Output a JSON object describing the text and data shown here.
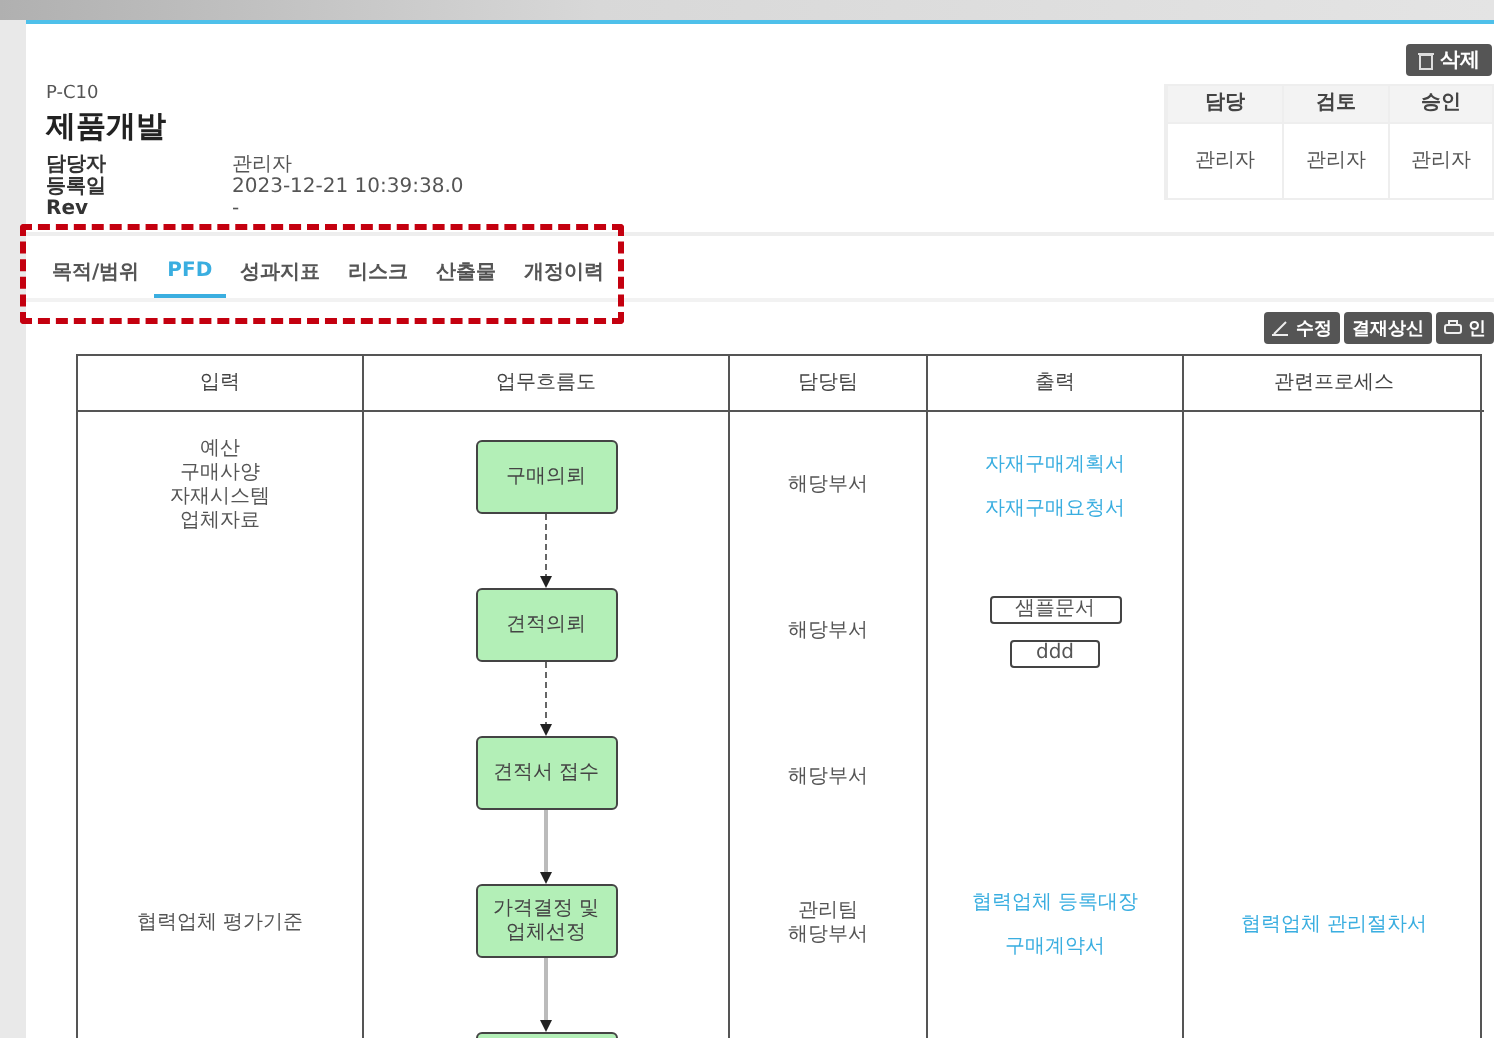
{
  "header": {
    "code": "P-C10",
    "title": "제품개발",
    "fields": [
      {
        "label": "담당자",
        "value": "관리자"
      },
      {
        "label": "등록일",
        "value": "2023-12-21 10:39:38.0"
      },
      {
        "label": "Rev",
        "value": "-"
      }
    ]
  },
  "delete_button": "삭제",
  "approval": {
    "columns": [
      "담당",
      "검토",
      "승인"
    ],
    "values": [
      "관리자",
      "관리자",
      "관리자"
    ]
  },
  "tabs": [
    {
      "label": "목적/범위",
      "selected": false
    },
    {
      "label": "PFD",
      "selected": true
    },
    {
      "label": "성과지표",
      "selected": false
    },
    {
      "label": "리스크",
      "selected": false
    },
    {
      "label": "산출물",
      "selected": false
    },
    {
      "label": "개정이력",
      "selected": false
    }
  ],
  "actions": [
    {
      "label": "수정",
      "kind": "edit"
    },
    {
      "label": "결재상신",
      "kind": "submit"
    },
    {
      "label": "인",
      "kind": "print"
    }
  ],
  "pfd": {
    "columns": [
      "입력",
      "업무흐름도",
      "담당팀",
      "출력",
      "관련프로세스"
    ],
    "rows": [
      {
        "input": [
          "예산",
          "구매사양",
          "자재시스템",
          "업체자료"
        ],
        "step": {
          "label": "구매의뢰",
          "arrow": true,
          "dashed": true
        },
        "team": [
          "해당부서"
        ],
        "outputs": [
          {
            "text": "자재구매계획서",
            "kind": "link"
          },
          {
            "text": "자재구매요청서",
            "kind": "link"
          }
        ],
        "processes": []
      },
      {
        "input": [],
        "step": {
          "label": "견적의뢰",
          "arrow": true,
          "dashed": true
        },
        "team": [
          "해당부서"
        ],
        "outputs": [
          {
            "text": "샘플문서",
            "kind": "document"
          },
          {
            "text": "ddd",
            "kind": "document"
          }
        ],
        "processes": []
      },
      {
        "input": [],
        "step": {
          "label": "견적서 접수",
          "arrow": true,
          "dashed": false
        },
        "team": [
          "해당부서"
        ],
        "outputs": [],
        "processes": []
      },
      {
        "input": [
          "협력업체 평가기준"
        ],
        "step": {
          "label": "가격결정 및\n업체선정",
          "arrow": true,
          "dashed": false
        },
        "team": [
          "관리팀",
          "해당부서"
        ],
        "outputs": [
          {
            "text": "협력업체 등록대장",
            "kind": "link"
          },
          {
            "text": "구매계약서",
            "kind": "link"
          }
        ],
        "processes": [
          "협력업체 관리절차서"
        ]
      },
      {
        "input": [],
        "step": {
          "arrow": false
        },
        "team": [],
        "outputs": [],
        "processes": []
      }
    ]
  }
}
